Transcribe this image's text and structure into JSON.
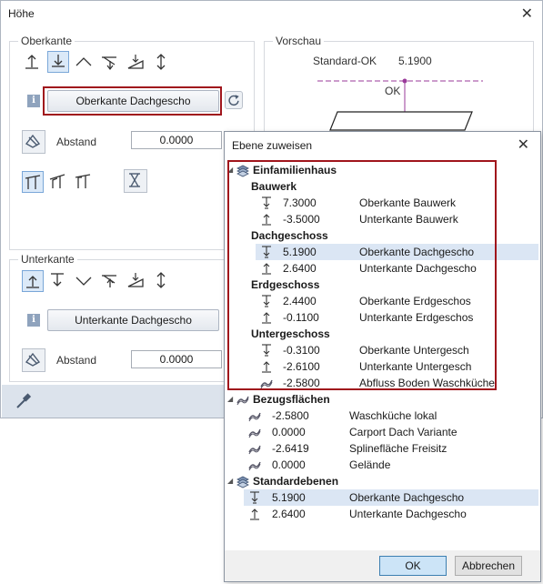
{
  "main": {
    "title": "Höhe",
    "close_glyph": "✕",
    "oberkante": {
      "legend": "Oberkante",
      "button_label": "Oberkante Dachgescho",
      "abstand_label": "Abstand",
      "abstand_value": "0.0000"
    },
    "unterkante": {
      "legend": "Unterkante",
      "button_label": "Unterkante Dachgescho",
      "abstand_label": "Abstand",
      "abstand_value": "0.0000"
    },
    "vorschau": {
      "legend": "Vorschau",
      "std_label": "Standard-OK",
      "std_value": "5.1900",
      "ok_label": "OK"
    },
    "info_glyph": "i"
  },
  "popup": {
    "title": "Ebene zuweisen",
    "close_glyph": "✕",
    "tree": {
      "root": "Einfamilienhaus",
      "groups": [
        {
          "name": "Bauwerk",
          "items": [
            {
              "value": "7.3000",
              "desc": "Oberkante Bauwerk",
              "icon": "level-top-icon"
            },
            {
              "value": "-3.5000",
              "desc": "Unterkante Bauwerk",
              "icon": "level-bottom-icon"
            }
          ]
        },
        {
          "name": "Dachgeschoss",
          "items": [
            {
              "value": "5.1900",
              "desc": "Oberkante Dachgescho",
              "icon": "level-top-icon",
              "selected": true
            },
            {
              "value": "2.6400",
              "desc": "Unterkante Dachgescho",
              "icon": "level-bottom-icon"
            }
          ]
        },
        {
          "name": "Erdgeschoss",
          "items": [
            {
              "value": "2.4400",
              "desc": "Oberkante Erdgeschos",
              "icon": "level-top-icon"
            },
            {
              "value": "-0.1100",
              "desc": "Unterkante Erdgeschos",
              "icon": "level-bottom-icon"
            }
          ]
        },
        {
          "name": "Untergeschoss",
          "items": [
            {
              "value": "-0.3100",
              "desc": "Oberkante Untergesch",
              "icon": "level-top-icon"
            },
            {
              "value": "-2.6100",
              "desc": "Unterkante Untergesch",
              "icon": "level-bottom-icon"
            },
            {
              "value": "-2.5800",
              "desc": "Abfluss Boden Waschküche",
              "icon": "free-surface-icon"
            }
          ]
        }
      ],
      "bezug": {
        "name": "Bezugsflächen",
        "items": [
          {
            "value": "-2.5800",
            "desc": "Waschküche lokal"
          },
          {
            "value": "0.0000",
            "desc": "Carport Dach Variante"
          },
          {
            "value": "-2.6419",
            "desc": "Splinefläche Freisitz"
          },
          {
            "value": "0.0000",
            "desc": "Gelände"
          }
        ]
      },
      "standard": {
        "name": "Standardebenen",
        "items": [
          {
            "value": "5.1900",
            "desc": "Oberkante Dachgescho",
            "icon": "level-top-icon",
            "selected": true
          },
          {
            "value": "2.6400",
            "desc": "Unterkante Dachgescho",
            "icon": "level-bottom-icon"
          }
        ]
      }
    },
    "ok_label": "OK",
    "cancel_label": "Abbrechen"
  },
  "colors": {
    "accent_red": "#a0151c",
    "selection": "#dbe6f4",
    "preview_magenta": "#9a3a9a"
  }
}
